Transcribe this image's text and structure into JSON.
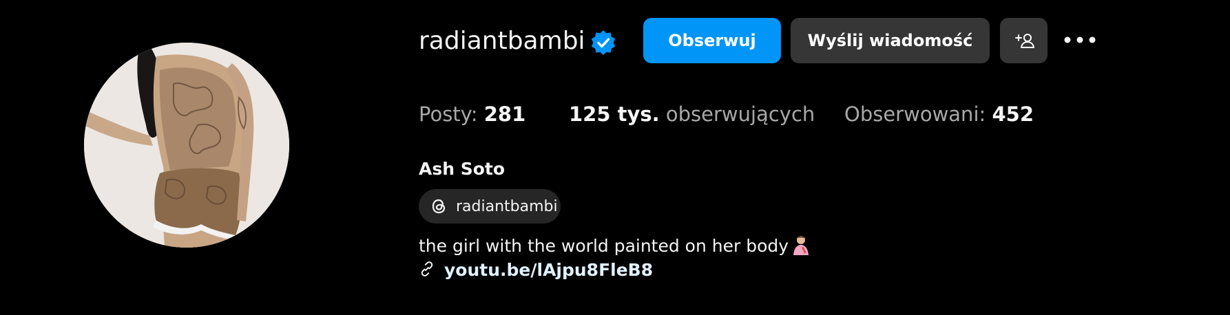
{
  "profile": {
    "username": "radiantbambi",
    "verified": true,
    "avatar_alt": "profile photo",
    "full_name": "Ash Soto",
    "threads_handle": "radiantbambi",
    "bio": "the girl with the world painted on her body",
    "link": "youtu.be/lAjpu8FleB8"
  },
  "actions": {
    "follow_label": "Obserwuj",
    "message_label": "Wyślij wiadomość"
  },
  "stats": {
    "posts_label": "Posty:",
    "posts_value": "281",
    "followers_value": "125 tys.",
    "followers_label": "obserwujących",
    "following_label": "Obserwowani:",
    "following_value": "452"
  },
  "colors": {
    "background": "#000000",
    "accent": "#0095f6",
    "secondary_button": "#363636",
    "pill": "#262626",
    "muted_text": "#a8a8a8",
    "link_text": "#e0f1ff"
  },
  "icons": {
    "verified": "verified-badge-icon",
    "suggest": "add-person-icon",
    "more": "more-horizontal-icon",
    "threads": "threads-icon",
    "link": "link-icon",
    "bio_emoji": "artist-emoji"
  }
}
